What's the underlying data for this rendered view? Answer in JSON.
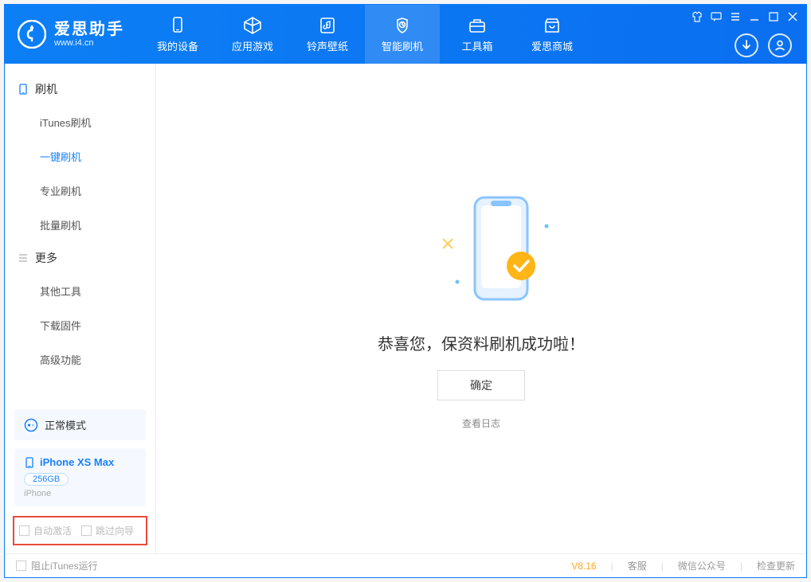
{
  "app": {
    "name": "爱思助手",
    "url": "www.i4.cn"
  },
  "tabs": [
    {
      "id": "device",
      "label": "我的设备"
    },
    {
      "id": "apps",
      "label": "应用游戏"
    },
    {
      "id": "ring",
      "label": "铃声壁纸"
    },
    {
      "id": "flash",
      "label": "智能刷机",
      "active": true
    },
    {
      "id": "toolbox",
      "label": "工具箱"
    },
    {
      "id": "store",
      "label": "爱思商城"
    }
  ],
  "sidebar": {
    "group1": {
      "title": "刷机",
      "items": [
        {
          "id": "itunes-flash",
          "label": "iTunes刷机"
        },
        {
          "id": "onekey-flash",
          "label": "一键刷机",
          "active": true
        },
        {
          "id": "pro-flash",
          "label": "专业刷机"
        },
        {
          "id": "batch-flash",
          "label": "批量刷机"
        }
      ]
    },
    "group2": {
      "title": "更多",
      "items": [
        {
          "id": "other-tools",
          "label": "其他工具"
        },
        {
          "id": "download-fw",
          "label": "下载固件"
        },
        {
          "id": "advanced",
          "label": "高级功能"
        }
      ]
    }
  },
  "mode": {
    "label": "正常模式"
  },
  "device": {
    "name": "iPhone XS Max",
    "storage": "256GB",
    "type": "iPhone"
  },
  "checks": {
    "auto_activate": "自动激活",
    "skip_guide": "跳过向导"
  },
  "main": {
    "success_msg": "恭喜您，保资料刷机成功啦！",
    "ok_btn": "确定",
    "view_log": "查看日志"
  },
  "statusbar": {
    "block_itunes": "阻止iTunes运行",
    "version": "V8.16",
    "links": [
      "客服",
      "微信公众号",
      "检查更新"
    ]
  }
}
